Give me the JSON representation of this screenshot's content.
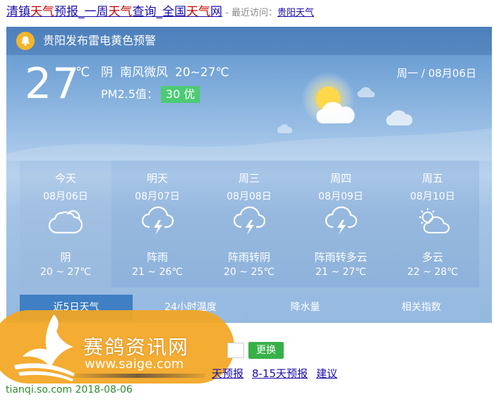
{
  "header": {
    "title_parts": [
      {
        "text": "清镇",
        "hl": false
      },
      {
        "text": "天气",
        "hl": true
      },
      {
        "text": "预报_一周",
        "hl": false
      },
      {
        "text": "天气",
        "hl": true
      },
      {
        "text": "查询_全国",
        "hl": false
      },
      {
        "text": "天气",
        "hl": true
      },
      {
        "text": "网",
        "hl": false
      }
    ],
    "recent_label": " - 最近访问：",
    "recent_link": "贵阳天气"
  },
  "alert": {
    "text": "贵阳发布雷电黄色预警",
    "icon": "bell-icon"
  },
  "current": {
    "temp": "27",
    "unit": "℃",
    "condition": "阴",
    "wind": "南风微风",
    "range": "20~27℃",
    "pm_label": "PM2.5值：",
    "pm_value": "30 优",
    "date": "周一 / 08月06日"
  },
  "forecast": [
    {
      "name": "今天",
      "date": "08月06日",
      "icon": "cloud-icon",
      "cond": "阴",
      "temp": "20 ~ 27℃"
    },
    {
      "name": "明天",
      "date": "08月07日",
      "icon": "thunder-cloud-icon",
      "cond": "阵雨",
      "temp": "21 ~ 26℃"
    },
    {
      "name": "周三",
      "date": "08月08日",
      "icon": "thunder-cloud-icon",
      "cond": "阵雨转阴",
      "temp": "20 ~ 25℃"
    },
    {
      "name": "周四",
      "date": "08月09日",
      "icon": "thunder-cloud-icon",
      "cond": "阵雨转多云",
      "temp": "21 ~ 27℃"
    },
    {
      "name": "周五",
      "date": "08月10日",
      "icon": "sun-cloud-icon",
      "cond": "多云",
      "temp": "22 ~ 28℃"
    }
  ],
  "tabs": [
    "近5日天气",
    "24小时温度",
    "降水量",
    "相关指数"
  ],
  "change_button": "更换",
  "links": [
    "天预报",
    "8-15天预报",
    "建议"
  ],
  "url": "tianqi.so.com 2018-08-06",
  "watermark": {
    "cn": "赛鸽资讯网",
    "en": "www.saige.com"
  },
  "colors": {
    "link": "#1a0dab",
    "highlight": "#cc0000",
    "pm_good": "#4ccb74",
    "button": "#38b049",
    "url": "#2e8b2e"
  }
}
